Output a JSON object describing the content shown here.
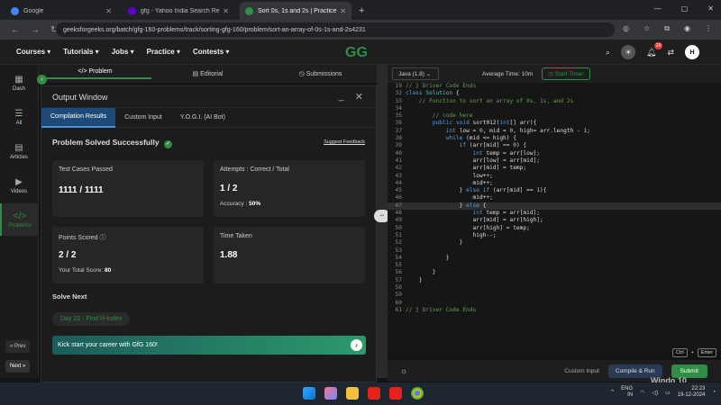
{
  "browser": {
    "tabs": [
      {
        "label": "Google",
        "color": "#4285f4"
      },
      {
        "label": "gfg - Yahoo India Search Results",
        "color": "#6001d2"
      },
      {
        "label": "Sort 0s, 1s and 2s | Practice | G...",
        "color": "#2f8d46"
      }
    ],
    "url": "geeksforgeeks.org/batch/gfg-160-problems/track/sorting-gfg-160/problem/sort-an-array-of-0s-1s-and-2s4231"
  },
  "header": {
    "menu": [
      "Courses ▾",
      "Tutorials ▾",
      "Jobs ▾",
      "Practice ▾",
      "Contests ▾"
    ],
    "logo": "GG",
    "notification_count": "29",
    "avatar": "H"
  },
  "sidebar": {
    "items": [
      "Dash",
      "All",
      "Articles",
      "Videos",
      "Problems"
    ],
    "prev": "Prev",
    "next": "Next"
  },
  "problem_tabs": [
    "Problem",
    "Editorial",
    "Submissions"
  ],
  "output_window": {
    "title": "Output Window",
    "tabs": [
      "Compilation Results",
      "Custom Input",
      "Y.O.G.I. (AI Bot)"
    ],
    "status": "Problem Solved Successfully",
    "feedback": "Suggest Feedback",
    "test_cases_label": "Test Cases Passed",
    "test_cases_value": "1111 / 1111",
    "attempts_label": "Attempts : Correct / Total",
    "attempts_value": "1 / 2",
    "accuracy_label": "Accuracy :",
    "accuracy_value": "50%",
    "points_label": "Points Scored",
    "points_value": "2 / 2",
    "total_score_label": "Your Total Score:",
    "total_score_value": "80",
    "time_label": "Time Taken",
    "time_value": "1.88",
    "solve_next": "Solve Next",
    "next_problem": "Day 22 - Find H-Index",
    "banner": "Kick start your career with GfG 160!"
  },
  "editor": {
    "language": "Java (1.8)",
    "average_time": "Average Time: 10m",
    "timer": "Start Timer",
    "lines": [
      [
        "19",
        "// } Driver Code Ends"
      ],
      [
        "32",
        "class Solution {"
      ],
      [
        "33",
        "    // Function to sort an array of 0s, 1s, and 2s"
      ],
      [
        "34",
        ""
      ],
      [
        "35",
        "        // code here"
      ],
      [
        "36",
        "        public void sort012(int[] arr){"
      ],
      [
        "37",
        "            int low = 0, mid = 0, high= arr.length - 1;"
      ],
      [
        "38",
        "            while (mid <= high) {"
      ],
      [
        "39",
        "                if (arr[mid] == 0) {"
      ],
      [
        "40",
        "                    int temp = arr[low];"
      ],
      [
        "41",
        "                    arr[low] = arr[mid];"
      ],
      [
        "42",
        "                    arr[mid] = temp;"
      ],
      [
        "43",
        "                    low++;"
      ],
      [
        "44",
        "                    mid++;"
      ],
      [
        "45",
        "                } else if (arr[mid] == 1){"
      ],
      [
        "46",
        "                    mid++;"
      ],
      [
        "47",
        "                } else {"
      ],
      [
        "48",
        "                    int temp = arr[mid];"
      ],
      [
        "49",
        "                    arr[mid] = arr[high];"
      ],
      [
        "50",
        "                    arr[high] = temp;"
      ],
      [
        "51",
        "                    high--;"
      ],
      [
        "52",
        "                }"
      ],
      [
        "53",
        ""
      ],
      [
        "54",
        "            }"
      ],
      [
        "55",
        ""
      ],
      [
        "56",
        "        }"
      ],
      [
        "57",
        "    }"
      ],
      [
        "58",
        ""
      ],
      [
        "59",
        ""
      ],
      [
        "60",
        ""
      ],
      [
        "61",
        "// } Driver Code Ends"
      ]
    ],
    "shortcut_keys": [
      "Ctrl",
      "+",
      "Enter"
    ],
    "custom_input": "Custom Input",
    "compile": "Compile & Run",
    "submit": "Submit"
  },
  "taskbar": {
    "lang": "ENG",
    "region": "IN",
    "time": "22:23",
    "date": "19-12-2024",
    "weather": "Windo 10"
  }
}
